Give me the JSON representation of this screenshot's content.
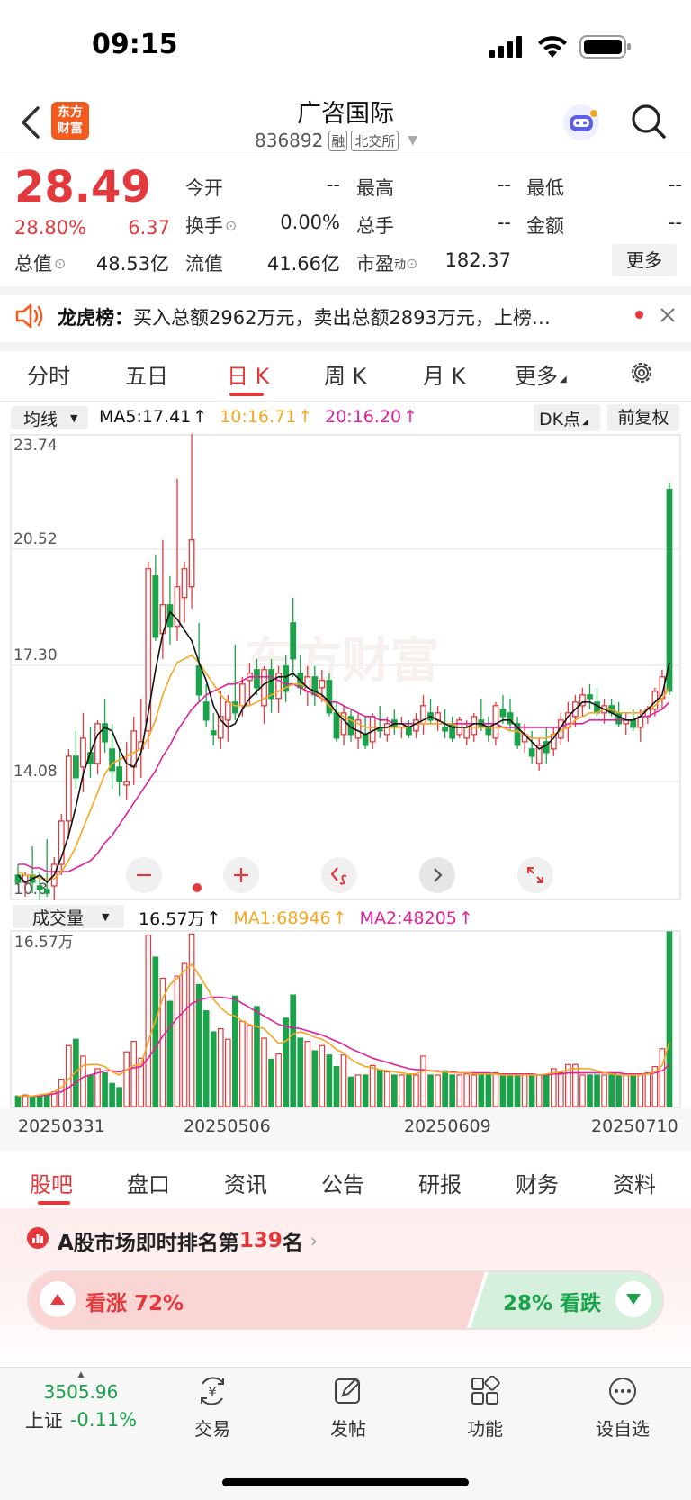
{
  "status": {
    "time": "09:15"
  },
  "header": {
    "logo_line1": "东方",
    "logo_line2": "财富",
    "stock_name": "广咨国际",
    "stock_code": "836892",
    "badge_margin": "融",
    "badge_exchange": "北交所"
  },
  "quote": {
    "price": "28.49",
    "change_pct": "28.80%",
    "change_amt": "6.37",
    "open_label": "今开",
    "open_value": "--",
    "high_label": "最高",
    "high_value": "--",
    "low_label": "最低",
    "low_value": "--",
    "turnover_label": "换手",
    "turnover_value": "0.00%",
    "volume_label": "总手",
    "volume_value": "--",
    "amount_label": "金额",
    "amount_value": "--",
    "mktcap_label": "总值",
    "mktcap_value": "48.53亿",
    "float_label": "流值",
    "float_value": "41.66亿",
    "pe_label": "市盈",
    "pe_sup": "动",
    "pe_value": "182.37",
    "more_button": "更多"
  },
  "notice": {
    "title": "龙虎榜：",
    "text": "买入总额2962万元，卖出总额2893万元，上榜…"
  },
  "chart_tabs": {
    "items": [
      "分时",
      "五日",
      "日 K",
      "周 K",
      "月 K",
      "更多"
    ],
    "active_index": 2
  },
  "chart_legend": {
    "indicator_select": "均线",
    "ma5": "MA5:17.41",
    "ma10": "10:16.71",
    "ma20": "20:16.20",
    "dk_button": "DK点",
    "adjust_button": "前复权",
    "color_ma5": "#111111",
    "color_ma10": "#f5a623",
    "color_ma20": "#e0219a"
  },
  "volume_legend": {
    "select": "成交量",
    "vol": "16.57万",
    "ma1": "MA1:68946",
    "ma2": "MA2:48205",
    "axis_max": "16.57万"
  },
  "chart_data": {
    "type": "candlestick",
    "y_ticks": [
      "23.74",
      "20.52",
      "17.30",
      "14.08",
      "10.8"
    ],
    "ylim": [
      10.8,
      23.74
    ],
    "x_labels": [
      "20250331",
      "20250506",
      "20250609",
      "20250710"
    ],
    "candles": [
      [
        11.5,
        11.8,
        11.2,
        11.3
      ],
      [
        11.3,
        11.6,
        10.9,
        11.5
      ],
      [
        11.5,
        12.3,
        11.0,
        11.3
      ],
      [
        11.2,
        11.6,
        10.8,
        11.1
      ],
      [
        11.1,
        12.5,
        10.9,
        11.0
      ],
      [
        11.2,
        12.0,
        10.8,
        11.8
      ],
      [
        11.8,
        13.2,
        11.5,
        13.0
      ],
      [
        13.0,
        15.0,
        12.5,
        14.8
      ],
      [
        14.8,
        15.5,
        13.9,
        14.2
      ],
      [
        14.5,
        16.0,
        13.8,
        15.3
      ],
      [
        14.9,
        15.6,
        14.2,
        14.6
      ],
      [
        14.6,
        15.8,
        14.3,
        15.7
      ],
      [
        15.7,
        16.4,
        14.9,
        15.2
      ],
      [
        15.0,
        15.7,
        13.9,
        14.4
      ],
      [
        14.5,
        15.0,
        13.7,
        14.1
      ],
      [
        14.0,
        15.2,
        13.6,
        14.1
      ],
      [
        14.5,
        15.9,
        14.0,
        15.5
      ],
      [
        15.0,
        16.4,
        14.2,
        15.2
      ],
      [
        15.5,
        20.2,
        15.0,
        20.0
      ],
      [
        19.8,
        20.4,
        18.0,
        18.1
      ],
      [
        18.2,
        20.8,
        17.5,
        19.0
      ],
      [
        19.0,
        19.8,
        17.9,
        18.4
      ],
      [
        18.4,
        22.5,
        18.0,
        19.5
      ],
      [
        19.2,
        20.2,
        18.5,
        20.0
      ],
      [
        19.5,
        23.9,
        18.9,
        20.8
      ],
      [
        17.3,
        18.5,
        16.3,
        16.5
      ],
      [
        16.3,
        16.8,
        15.6,
        15.8
      ],
      [
        15.5,
        16.0,
        15.1,
        15.4
      ],
      [
        15.3,
        16.6,
        15.0,
        15.9
      ],
      [
        15.8,
        16.5,
        15.2,
        16.3
      ],
      [
        16.3,
        17.9,
        15.8,
        16.0
      ],
      [
        16.2,
        17.0,
        15.9,
        16.8
      ],
      [
        16.9,
        17.4,
        16.2,
        17.1
      ],
      [
        17.2,
        17.5,
        16.5,
        16.7
      ],
      [
        16.2,
        17.3,
        15.7,
        17.2
      ],
      [
        17.2,
        17.5,
        16.0,
        16.4
      ],
      [
        16.4,
        17.3,
        16.0,
        17.1
      ],
      [
        17.3,
        17.6,
        16.3,
        16.6
      ],
      [
        18.5,
        19.2,
        17.0,
        17.5
      ],
      [
        17.1,
        17.6,
        16.5,
        16.7
      ],
      [
        16.6,
        17.3,
        16.2,
        17.0
      ],
      [
        17.0,
        17.3,
        16.2,
        16.5
      ],
      [
        16.7,
        17.2,
        16.3,
        16.9
      ],
      [
        16.9,
        17.1,
        15.9,
        16.0
      ],
      [
        16.0,
        16.3,
        15.2,
        15.3
      ],
      [
        15.4,
        16.2,
        15.1,
        16.0
      ],
      [
        15.9,
        16.1,
        15.2,
        15.4
      ],
      [
        15.3,
        16.0,
        15.0,
        15.8
      ],
      [
        15.4,
        15.9,
        15.0,
        15.1
      ],
      [
        15.2,
        16.0,
        15.0,
        15.9
      ],
      [
        15.6,
        16.2,
        15.3,
        15.5
      ],
      [
        15.4,
        15.9,
        15.2,
        15.7
      ],
      [
        15.8,
        16.1,
        15.4,
        15.6
      ],
      [
        15.6,
        15.9,
        15.3,
        15.7
      ],
      [
        15.6,
        15.8,
        15.3,
        15.4
      ],
      [
        15.5,
        16.0,
        15.3,
        15.8
      ],
      [
        15.7,
        16.5,
        15.4,
        16.2
      ],
      [
        16.0,
        16.4,
        15.7,
        15.8
      ],
      [
        15.8,
        16.2,
        15.5,
        16.0
      ],
      [
        15.6,
        16.1,
        15.3,
        15.5
      ],
      [
        15.7,
        15.9,
        15.2,
        15.3
      ],
      [
        15.4,
        15.9,
        15.3,
        15.8
      ],
      [
        15.3,
        15.8,
        15.1,
        15.6
      ],
      [
        15.4,
        16.0,
        15.2,
        15.9
      ],
      [
        15.8,
        16.4,
        15.5,
        15.6
      ],
      [
        15.6,
        15.9,
        15.2,
        15.4
      ],
      [
        15.3,
        16.3,
        15.1,
        16.2
      ],
      [
        16.1,
        16.5,
        15.7,
        15.9
      ],
      [
        16.0,
        16.4,
        15.5,
        15.7
      ],
      [
        15.7,
        15.9,
        15.0,
        15.1
      ],
      [
        15.2,
        15.7,
        14.9,
        15.4
      ],
      [
        15.0,
        15.5,
        14.6,
        14.8
      ],
      [
        14.6,
        15.3,
        14.4,
        15.1
      ],
      [
        15.2,
        15.6,
        14.6,
        14.9
      ],
      [
        15.0,
        15.6,
        14.8,
        15.4
      ],
      [
        15.3,
        16.0,
        15.1,
        15.8
      ],
      [
        15.6,
        16.3,
        15.2,
        16.0
      ],
      [
        15.9,
        16.5,
        15.6,
        16.3
      ],
      [
        16.2,
        16.7,
        15.9,
        16.5
      ],
      [
        16.5,
        16.8,
        16.1,
        16.4
      ],
      [
        16.3,
        16.7,
        15.9,
        16.0
      ],
      [
        16.0,
        16.4,
        15.7,
        16.2
      ],
      [
        16.2,
        16.4,
        15.9,
        16.0
      ],
      [
        16.0,
        16.3,
        15.6,
        15.7
      ],
      [
        15.7,
        16.0,
        15.4,
        15.8
      ],
      [
        15.8,
        16.1,
        15.5,
        15.6
      ],
      [
        15.6,
        16.1,
        15.2,
        15.9
      ],
      [
        15.9,
        16.2,
        15.7,
        16.1
      ],
      [
        16.1,
        16.7,
        15.9,
        16.6
      ],
      [
        16.4,
        17.2,
        16.1,
        17.0
      ],
      [
        22.2,
        22.4,
        16.5,
        16.6
      ]
    ],
    "ma5": [
      11.5,
      11.3,
      11.4,
      11.5,
      11.3,
      11.5,
      12.0,
      12.6,
      13.4,
      14.3,
      14.9,
      15.4,
      15.6,
      15.5,
      15.0,
      14.6,
      14.5,
      14.9,
      16.0,
      17.2,
      18.2,
      18.8,
      18.6,
      18.3,
      18.0,
      17.4,
      16.9,
      16.2,
      15.8,
      15.6,
      15.7,
      16.1,
      16.4,
      16.6,
      16.8,
      16.9,
      17.0,
      17.0,
      17.1,
      16.9,
      16.7,
      16.6,
      16.5,
      16.3,
      16.0,
      15.8,
      15.6,
      15.5,
      15.4,
      15.5,
      15.6,
      15.6,
      15.7,
      15.7,
      15.6,
      15.7,
      15.8,
      15.9,
      15.8,
      15.7,
      15.6,
      15.6,
      15.6,
      15.7,
      15.7,
      15.6,
      15.7,
      15.8,
      15.8,
      15.6,
      15.4,
      15.2,
      15.0,
      15.1,
      15.3,
      15.6,
      15.9,
      16.1,
      16.3,
      16.3,
      16.2,
      16.1,
      16.0,
      15.9,
      15.8,
      15.8,
      15.9,
      16.1,
      16.3,
      16.5,
      17.4
    ],
    "ma10": [
      11.6,
      11.5,
      11.5,
      11.4,
      11.4,
      11.4,
      11.6,
      11.9,
      12.3,
      12.8,
      13.3,
      13.8,
      14.3,
      14.6,
      14.7,
      14.8,
      14.9,
      15.0,
      15.3,
      15.8,
      16.5,
      17.0,
      17.4,
      17.5,
      17.6,
      17.4,
      17.1,
      16.8,
      16.5,
      16.3,
      16.2,
      16.2,
      16.2,
      16.3,
      16.4,
      16.5,
      16.6,
      16.7,
      16.8,
      16.8,
      16.7,
      16.6,
      16.4,
      16.2,
      16.0,
      15.9,
      15.8,
      15.7,
      15.6,
      15.6,
      15.6,
      15.6,
      15.6,
      15.6,
      15.6,
      15.7,
      15.7,
      15.7,
      15.7,
      15.7,
      15.7,
      15.6,
      15.6,
      15.6,
      15.6,
      15.6,
      15.6,
      15.6,
      15.5,
      15.5,
      15.4,
      15.3,
      15.3,
      15.3,
      15.4,
      15.5,
      15.6,
      15.8,
      15.9,
      16.0,
      16.0,
      16.1,
      16.1,
      16.0,
      16.0,
      16.0,
      16.0,
      16.1,
      16.2,
      16.4,
      16.7
    ],
    "ma20": [
      11.8,
      11.8,
      11.7,
      11.7,
      11.6,
      11.6,
      11.6,
      11.6,
      11.7,
      11.8,
      11.9,
      12.1,
      12.4,
      12.6,
      12.9,
      13.2,
      13.5,
      13.8,
      14.1,
      14.4,
      14.8,
      15.1,
      15.5,
      15.8,
      16.1,
      16.3,
      16.5,
      16.6,
      16.7,
      16.8,
      16.8,
      16.9,
      17.0,
      17.0,
      17.0,
      17.0,
      16.9,
      16.8,
      16.8,
      16.7,
      16.6,
      16.5,
      16.4,
      16.3,
      16.3,
      16.2,
      16.1,
      16.0,
      15.9,
      15.9,
      15.8,
      15.8,
      15.7,
      15.7,
      15.7,
      15.7,
      15.7,
      15.7,
      15.7,
      15.7,
      15.7,
      15.7,
      15.7,
      15.7,
      15.7,
      15.7,
      15.7,
      15.6,
      15.6,
      15.6,
      15.6,
      15.6,
      15.6,
      15.6,
      15.6,
      15.6,
      15.7,
      15.7,
      15.7,
      15.8,
      15.8,
      15.8,
      15.8,
      15.8,
      15.8,
      15.8,
      15.9,
      15.9,
      16.0,
      16.1,
      16.3
    ],
    "volume": [
      1.0,
      1.1,
      1.0,
      1.0,
      1.2,
      1.4,
      2.6,
      5.8,
      6.4,
      4.8,
      3.0,
      3.6,
      3.2,
      2.2,
      1.8,
      5.2,
      6.2,
      4.6,
      16.3,
      14.2,
      12.2,
      10.0,
      12.4,
      13.6,
      16.4,
      11.6,
      9.1,
      7.1,
      7.4,
      6.4,
      10.5,
      8.1,
      7.7,
      9.5,
      6.5,
      4.5,
      5.0,
      8.4,
      10.6,
      6.5,
      6.2,
      5.3,
      5.8,
      4.9,
      3.8,
      4.9,
      2.8,
      3.0,
      3.0,
      3.9,
      3.5,
      3.3,
      3.0,
      3.0,
      3.0,
      3.0,
      4.8,
      3.0,
      3.0,
      3.4,
      3.0,
      3.0,
      3.1,
      3.0,
      3.2,
      3.0,
      3.2,
      3.0,
      3.0,
      3.0,
      3.1,
      3.0,
      3.0,
      3.0,
      3.6,
      3.2,
      4.0,
      4.0,
      3.0,
      3.0,
      3.0,
      3.0,
      3.0,
      3.0,
      3.0,
      3.0,
      3.0,
      3.2,
      3.8,
      5.5,
      16.6
    ],
    "vol_ma1": [
      1.0,
      1.0,
      1.0,
      1.1,
      1.2,
      1.4,
      1.8,
      2.6,
      3.3,
      3.9,
      4.0,
      4.0,
      3.8,
      3.3,
      3.0,
      3.5,
      3.9,
      4.0,
      6.2,
      8.2,
      10.3,
      11.6,
      12.2,
      12.9,
      13.5,
      12.5,
      11.4,
      10.2,
      9.4,
      8.8,
      8.6,
      8.1,
      7.8,
      7.6,
      7.4,
      6.7,
      6.0,
      6.2,
      6.9,
      7.1,
      6.9,
      6.6,
      6.4,
      6.0,
      5.4,
      5.1,
      4.5,
      4.1,
      3.8,
      3.7,
      3.5,
      3.4,
      3.3,
      3.2,
      3.1,
      3.1,
      3.4,
      3.4,
      3.3,
      3.3,
      3.2,
      3.2,
      3.2,
      3.1,
      3.1,
      3.1,
      3.1,
      3.0,
      3.0,
      3.0,
      3.0,
      3.0,
      3.0,
      3.1,
      3.2,
      3.3,
      3.5,
      3.6,
      3.6,
      3.6,
      3.4,
      3.2,
      3.1,
      3.0,
      3.0,
      3.0,
      3.0,
      3.1,
      3.3,
      3.9,
      6.1
    ],
    "vol_ma2": [
      1.0,
      1.0,
      1.0,
      1.0,
      1.1,
      1.2,
      1.4,
      1.8,
      2.3,
      2.8,
      3.0,
      3.2,
      3.4,
      3.4,
      3.3,
      3.5,
      3.7,
      3.8,
      4.6,
      5.6,
      6.7,
      7.6,
      8.4,
      9.1,
      9.8,
      10.1,
      10.3,
      10.4,
      10.4,
      10.3,
      10.2,
      9.8,
      9.4,
      9.0,
      8.6,
      8.2,
      7.8,
      7.6,
      7.5,
      7.4,
      7.2,
      7.0,
      6.8,
      6.5,
      6.2,
      5.9,
      5.5,
      5.2,
      4.9,
      4.6,
      4.4,
      4.2,
      4.0,
      3.8,
      3.6,
      3.5,
      3.5,
      3.4,
      3.4,
      3.3,
      3.3,
      3.2,
      3.2,
      3.2,
      3.2,
      3.2,
      3.1,
      3.1,
      3.1,
      3.1,
      3.1,
      3.1,
      3.0,
      3.0,
      3.1,
      3.1,
      3.2,
      3.2,
      3.2,
      3.2,
      3.2,
      3.2,
      3.2,
      3.2,
      3.1,
      3.1,
      3.1,
      3.1,
      3.2,
      3.4,
      4.0
    ],
    "color_up": "#e4393c",
    "color_down": "#1aa34a"
  },
  "bottom_tabs": {
    "items": [
      "股吧",
      "盘口",
      "资讯",
      "公告",
      "研报",
      "财务",
      "资料"
    ],
    "active_index": 0
  },
  "ranking": {
    "prefix": "A股市场即时排名第",
    "rank": "139",
    "suffix": "名"
  },
  "sentiment": {
    "bull_label": "看涨 72%",
    "bear_label": "28% 看跌",
    "bull_fraction": 0.72
  },
  "bottom_nav": {
    "index_value": "3505.96",
    "index_name": "上证",
    "index_change": "-0.11%",
    "trade": "交易",
    "post": "发帖",
    "features": "功能",
    "watchlist": "设自选"
  }
}
